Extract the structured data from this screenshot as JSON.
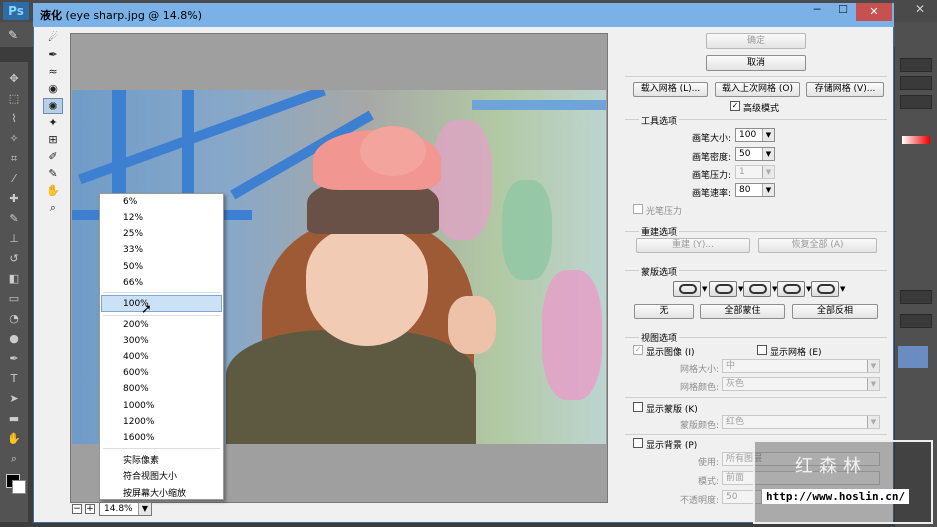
{
  "ps": {
    "logo": "Ps",
    "brush_glyph": "✎",
    "close_glyph": "✕"
  },
  "dialog": {
    "title_cn": "液化",
    "title_file": " (eye sharp.jpg @ 14.8%)",
    "min_glyph": "─",
    "max_glyph": "☐",
    "close_glyph": "✕"
  },
  "zoom": {
    "current": "14.8%",
    "options": [
      "6%",
      "12%",
      "25%",
      "33%",
      "50%",
      "66%",
      "100%",
      "200%",
      "300%",
      "400%",
      "600%",
      "800%",
      "1000%",
      "1200%",
      "1600%"
    ],
    "highlighted": "100%",
    "extra": [
      "实际像素",
      "符合视图大小",
      "按屏幕大小缩放"
    ]
  },
  "panel": {
    "ok": "确定",
    "cancel": "取消",
    "load_mesh": "载入网格 (L)...",
    "load_last_mesh": "载入上次网格 (O)",
    "save_mesh": "存储网格 (V)...",
    "advanced_mode": "高级模式",
    "tool_options": {
      "title": "工具选项",
      "brush_size_label": "画笔大小:",
      "brush_size": "100",
      "brush_density_label": "画笔密度:",
      "brush_density": "50",
      "brush_pressure_label": "画笔压力:",
      "brush_pressure": "1",
      "brush_rate_label": "画笔速率:",
      "brush_rate": "80",
      "stylus_pressure": "光笔压力"
    },
    "reconstruct": {
      "title": "重建选项",
      "reconstruct_btn": "重建 (Y)...",
      "restore_all_btn": "恢复全部 (A)"
    },
    "mask": {
      "title": "蒙版选项",
      "none": "无",
      "mask_all": "全部蒙住",
      "invert_all": "全部反相"
    },
    "view": {
      "title": "视图选项",
      "show_image": "显示图像 (I)",
      "show_mesh": "显示网格 (E)",
      "mesh_size_label": "网格大小:",
      "mesh_size": "中",
      "mesh_color_label": "网格颜色:",
      "mesh_color": "灰色",
      "show_mask": "显示蒙版 (K)",
      "mask_color_label": "蒙版颜色:",
      "mask_color": "红色",
      "show_backdrop": "显示背景 (P)",
      "use_label": "使用:",
      "use_value": "所有图层",
      "mode_label": "模式:",
      "mode_value": "前面",
      "opacity_label": "不透明度:",
      "opacity_value": "50"
    }
  },
  "watermark": {
    "title": "红森林",
    "url": "http://www.hoslin.cn/"
  }
}
